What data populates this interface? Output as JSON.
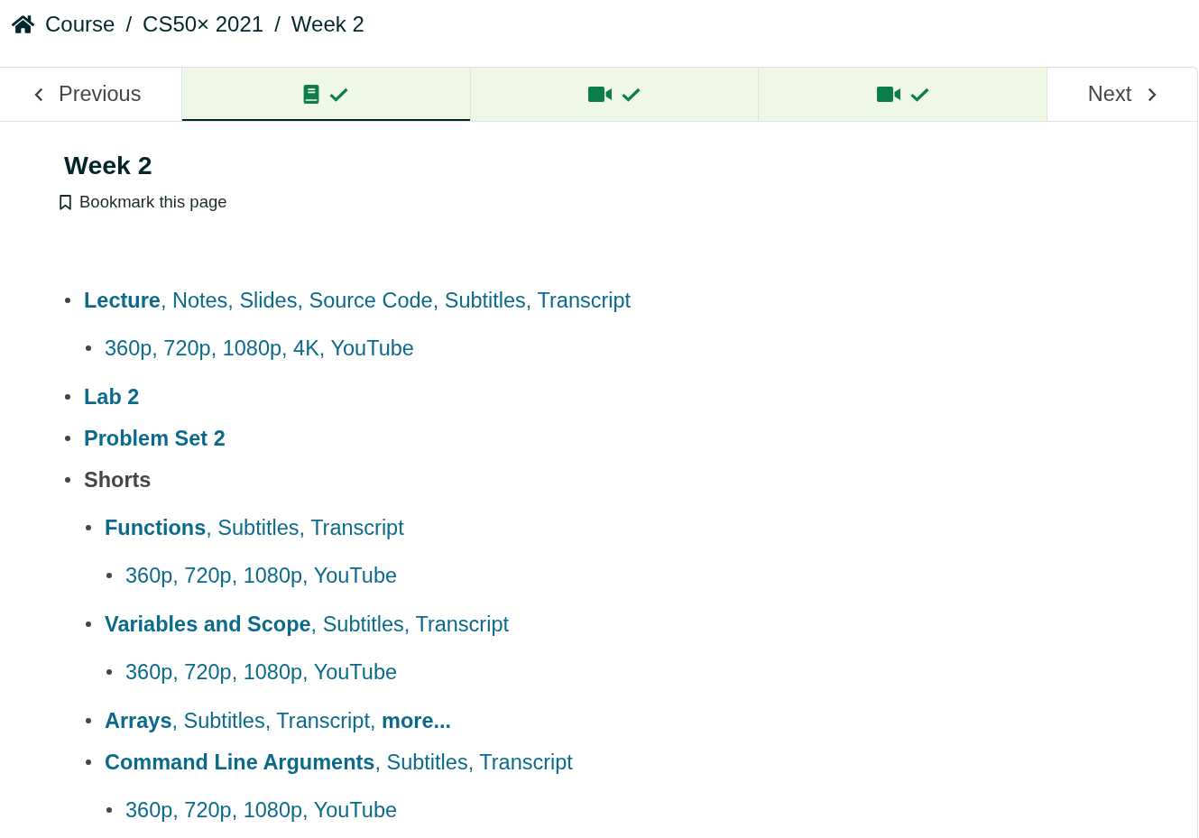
{
  "breadcrumb": {
    "items": [
      {
        "label": "Course"
      },
      {
        "separator": "/",
        "label": "CS50× 2021"
      },
      {
        "separator": "/",
        "label": "Week 2"
      }
    ]
  },
  "navigation": {
    "previous": "Previous",
    "units": [
      {
        "kind": "book",
        "completed": true,
        "selected": true
      },
      {
        "kind": "video",
        "completed": true,
        "selected": false
      },
      {
        "kind": "video",
        "completed": true,
        "selected": false
      }
    ],
    "next": "Next"
  },
  "content": {
    "title": "Week 2",
    "bookmark": "Bookmark this page",
    "items": [
      {
        "kind": "links",
        "links": [
          {
            "text": "Lecture",
            "bold": true,
            "after": ","
          },
          {
            "text": "Notes",
            "after": ","
          },
          {
            "text": "Slides",
            "after": ","
          },
          {
            "text": "Source Code",
            "after": ","
          },
          {
            "text": "Subtitles",
            "after": ","
          },
          {
            "text": "Transcript"
          }
        ],
        "children": [
          {
            "kind": "links",
            "links": [
              {
                "text": "360p",
                "after": ","
              },
              {
                "text": "720p",
                "after": ","
              },
              {
                "text": "1080p",
                "after": ","
              },
              {
                "text": "4K",
                "after": ","
              },
              {
                "text": "YouTube"
              }
            ]
          }
        ]
      },
      {
        "kind": "links",
        "links": [
          {
            "text": "Lab 2",
            "bold": true
          }
        ]
      },
      {
        "kind": "links",
        "links": [
          {
            "text": "Problem Set 2",
            "bold": true
          }
        ]
      },
      {
        "kind": "label",
        "label": "Shorts",
        "children": [
          {
            "kind": "links",
            "links": [
              {
                "text": "Functions",
                "bold": true,
                "after": ","
              },
              {
                "text": "Subtitles",
                "after": ","
              },
              {
                "text": "Transcript"
              }
            ],
            "children": [
              {
                "kind": "links",
                "links": [
                  {
                    "text": "360p",
                    "after": ","
                  },
                  {
                    "text": "720p",
                    "after": ","
                  },
                  {
                    "text": "1080p",
                    "after": ","
                  },
                  {
                    "text": "YouTube"
                  }
                ]
              }
            ]
          },
          {
            "kind": "links",
            "links": [
              {
                "text": "Variables and Scope",
                "bold": true,
                "after": ","
              },
              {
                "text": "Subtitles",
                "after": ","
              },
              {
                "text": "Transcript"
              }
            ],
            "children": [
              {
                "kind": "links",
                "links": [
                  {
                    "text": "360p",
                    "after": ","
                  },
                  {
                    "text": "720p",
                    "after": ","
                  },
                  {
                    "text": "1080p",
                    "after": ","
                  },
                  {
                    "text": "YouTube"
                  }
                ]
              }
            ]
          },
          {
            "kind": "links",
            "links": [
              {
                "text": "Arrays",
                "bold": true,
                "after": ","
              },
              {
                "text": "Subtitles",
                "after": ","
              },
              {
                "text": "Transcript",
                "after": ","
              },
              {
                "text": "more...",
                "bold": true
              }
            ]
          },
          {
            "kind": "links",
            "links": [
              {
                "text": "Command Line Arguments",
                "bold": true,
                "after": ","
              },
              {
                "text": "Subtitles",
                "after": ","
              },
              {
                "text": "Transcript"
              }
            ],
            "children": [
              {
                "kind": "links",
                "links": [
                  {
                    "text": "360p",
                    "after": ","
                  },
                  {
                    "text": "720p",
                    "after": ","
                  },
                  {
                    "text": "1080p",
                    "after": ","
                  },
                  {
                    "text": "YouTube"
                  }
                ]
              }
            ]
          }
        ]
      }
    ]
  }
}
